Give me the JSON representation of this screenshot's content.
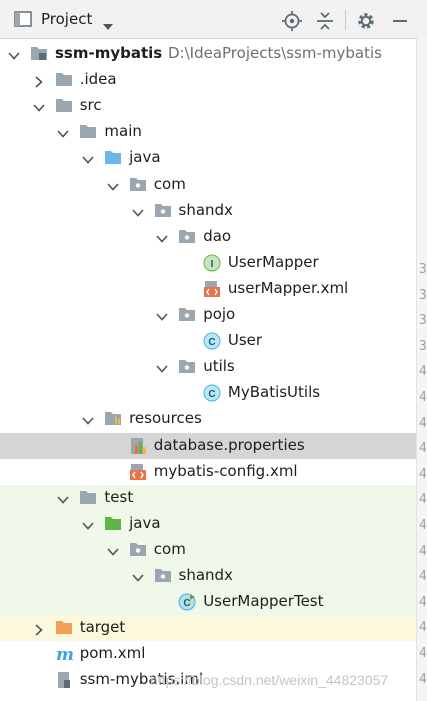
{
  "header": {
    "title": "Project"
  },
  "tree": [
    {
      "label": "ssm-mybatis",
      "path": "D:\\IdeaProjects\\ssm-mybatis",
      "icon": "module-folder-icon",
      "bold": true
    },
    {
      "label": ".idea",
      "icon": "folder-icon"
    },
    {
      "label": "src",
      "icon": "folder-icon"
    },
    {
      "label": "main",
      "icon": "folder-icon"
    },
    {
      "label": "java",
      "icon": "source-folder-icon"
    },
    {
      "label": "com",
      "icon": "package-icon"
    },
    {
      "label": "shandx",
      "icon": "package-icon"
    },
    {
      "label": "dao",
      "icon": "package-icon"
    },
    {
      "label": "UserMapper",
      "icon": "interface-icon",
      "icon_letter": "I"
    },
    {
      "label": "userMapper.xml",
      "icon": "xml-file-icon"
    },
    {
      "label": "pojo",
      "icon": "package-icon"
    },
    {
      "label": "User",
      "icon": "class-icon",
      "icon_letter": "C"
    },
    {
      "label": "utils",
      "icon": "package-icon"
    },
    {
      "label": "MyBatisUtils",
      "icon": "class-icon",
      "icon_letter": "C"
    },
    {
      "label": "resources",
      "icon": "resources-folder-icon"
    },
    {
      "label": "database.properties",
      "icon": "properties-file-icon",
      "selected": true
    },
    {
      "label": "mybatis-config.xml",
      "icon": "xml-file-icon"
    },
    {
      "label": "test",
      "icon": "folder-icon"
    },
    {
      "label": "java",
      "icon": "test-source-folder-icon"
    },
    {
      "label": "com",
      "icon": "package-icon"
    },
    {
      "label": "shandx",
      "icon": "package-icon"
    },
    {
      "label": "UserMapperTest",
      "icon": "test-class-icon",
      "icon_letter": "C"
    },
    {
      "label": "target",
      "icon": "excluded-folder-icon"
    },
    {
      "label": "pom.xml",
      "icon": "maven-icon",
      "icon_letter": "m"
    },
    {
      "label": "ssm-mybatis.iml",
      "icon": "iml-file-icon"
    }
  ],
  "gutter_numbers": [
    "3",
    "3",
    "3",
    "3",
    "4",
    "4",
    "4",
    "4",
    "4",
    "4",
    "4",
    "4",
    "4",
    "4",
    "4",
    "4",
    "4"
  ],
  "watermark": "https://blog.csdn.net/weixin_44823057",
  "colors": {
    "folder": "#9aa7b0",
    "source_folder": "#6eb6e8",
    "test_folder": "#62b543",
    "excluded_folder": "#f0a05a",
    "class": "#40b6e0",
    "interface": "#62b543",
    "selected_row": "#d5d5d5",
    "test_row": "#eff8e9",
    "excluded_row": "#fbf8dc"
  }
}
